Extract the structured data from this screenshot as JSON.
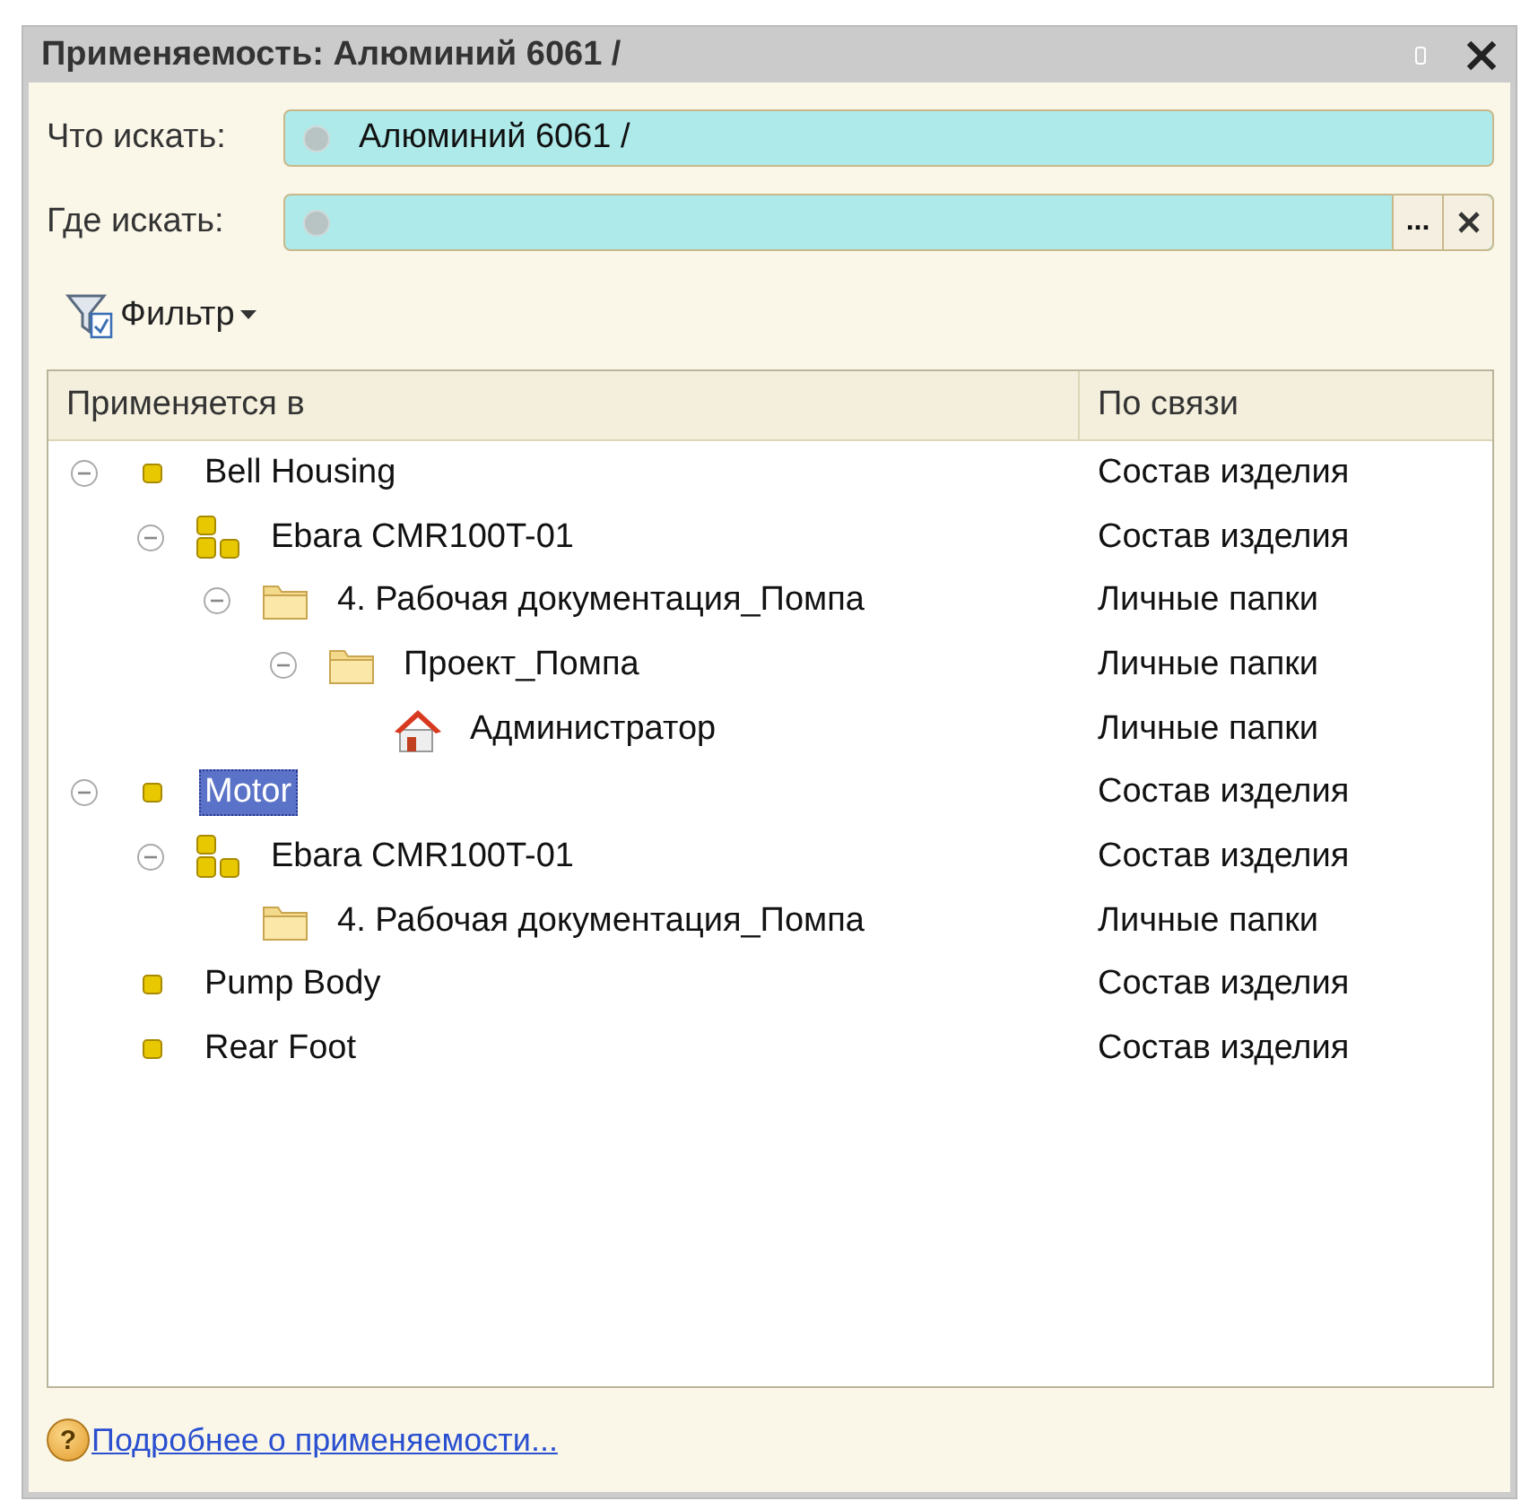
{
  "window": {
    "title": "Применяемость: Алюминий 6061 /"
  },
  "fields": [
    {
      "label": "Что искать:",
      "value": "Алюминий 6061 /",
      "clearable": false
    },
    {
      "label": "Где искать:",
      "select_button": "...",
      "clearable": true
    }
  ],
  "filter": {
    "label": "Фильтр"
  },
  "table": {
    "columns": [
      "Применяется в",
      "По связи"
    ],
    "rows": [
      {
        "name": "Bell Housing",
        "link": "Состав изделия",
        "kind": "part",
        "expanded": true,
        "selected": false,
        "children": [
          {
            "name": "Ebara CMR100T-01",
            "link": "Состав изделия",
            "kind": "assembly",
            "expanded": true,
            "selected": false,
            "children": [
              {
                "name": "4. Рабочая документация_Помпа",
                "link": "Личные папки",
                "kind": "folder",
                "expanded": true,
                "selected": false,
                "children": [
                  {
                    "name": "Проект_Помпа",
                    "link": "Личные папки",
                    "kind": "folder",
                    "expanded": true,
                    "selected": false,
                    "children": [
                      {
                        "name": "Администратор",
                        "link": "Личные папки",
                        "kind": "user",
                        "selected": false
                      }
                    ]
                  }
                ]
              }
            ]
          }
        ]
      },
      {
        "name": "Motor",
        "link": "Состав изделия",
        "kind": "part",
        "expanded": true,
        "selected": true,
        "children": [
          {
            "name": "Ebara CMR100T-01",
            "link": "Состав изделия",
            "kind": "assembly",
            "expanded": true,
            "selected": false,
            "children": [
              {
                "name": "4. Рабочая документация_Помпа",
                "link": "Личные папки",
                "kind": "folder",
                "selected": false
              }
            ]
          }
        ]
      },
      {
        "name": "Pump Body",
        "link": "Состав изделия",
        "kind": "part",
        "selected": false
      },
      {
        "name": "Rear Foot",
        "link": "Состав изделия",
        "kind": "part",
        "selected": false
      }
    ]
  },
  "help": {
    "icon": "?",
    "link": "Подробнее о применяемости..."
  }
}
